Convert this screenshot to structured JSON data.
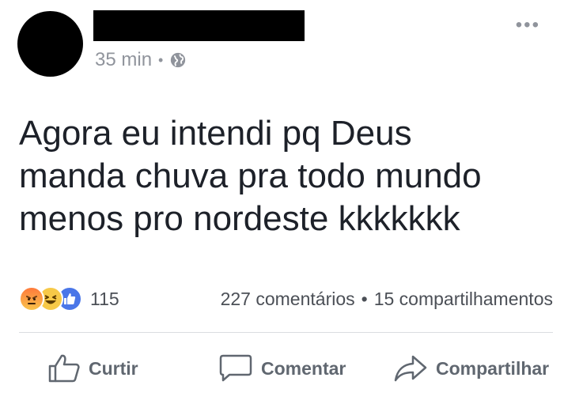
{
  "post": {
    "time": "35 min",
    "dot": "•",
    "more": "•••",
    "text_lines": [
      "Agora eu intendi pq Deus",
      "manda chuva pra todo mundo",
      "menos pro nordeste kkkkkkk"
    ]
  },
  "stats": {
    "reaction_count": "115",
    "comments": "227 comentários",
    "separator": "•",
    "shares": "15 compartilhamentos"
  },
  "actions": {
    "like": "Curtir",
    "comment": "Comentar",
    "share": "Compartilhar"
  },
  "icons": {
    "reactions": [
      "angry-icon",
      "haha-icon",
      "like-icon"
    ]
  },
  "colors": {
    "text_primary": "#1d2129",
    "text_secondary": "#90949c",
    "like_blue": "#4a76e8"
  }
}
